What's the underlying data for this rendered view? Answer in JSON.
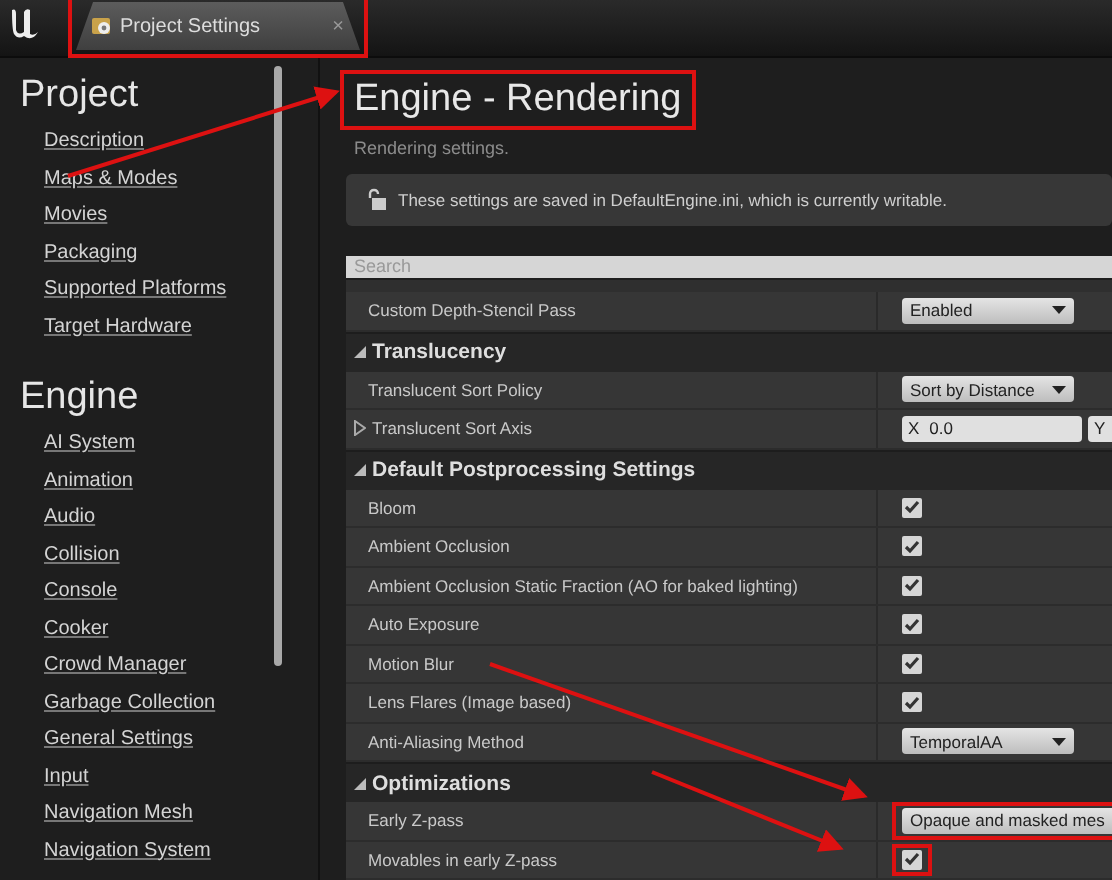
{
  "tab": {
    "title": "Project Settings",
    "close": "×",
    "highlighted": true
  },
  "sidebar": {
    "groups": [
      {
        "heading": "Project",
        "items": [
          "Description",
          "Maps & Modes",
          "Movies",
          "Packaging",
          "Supported Platforms",
          "Target Hardware"
        ]
      },
      {
        "heading": "Engine",
        "items": [
          "AI System",
          "Animation",
          "Audio",
          "Collision",
          "Console",
          "Cooker",
          "Crowd Manager",
          "Garbage Collection",
          "General Settings",
          "Input",
          "Navigation Mesh",
          "Navigation System"
        ]
      }
    ]
  },
  "page": {
    "title": "Engine - Rendering",
    "title_highlighted": true,
    "subtitle": "Rendering settings.",
    "notice": "These settings are saved in DefaultEngine.ini, which is currently writable.",
    "search": {
      "placeholder": "Search"
    }
  },
  "sections": [
    {
      "rows": [
        {
          "kind": "dropdown",
          "label": "Custom Depth-Stencil Pass",
          "value": "Enabled"
        }
      ]
    },
    {
      "title": "Translucency",
      "expanded": true,
      "rows": [
        {
          "kind": "dropdown",
          "label": "Translucent Sort Policy",
          "value": "Sort by Distance"
        },
        {
          "kind": "vector",
          "label": "Translucent Sort Axis",
          "expanded": false,
          "fields": [
            {
              "axis": "X",
              "value": "0.0"
            },
            {
              "axis": "Y"
            }
          ]
        }
      ]
    },
    {
      "title": "Default Postprocessing Settings",
      "expanded": true,
      "rows": [
        {
          "kind": "checkbox",
          "label": "Bloom",
          "checked": true
        },
        {
          "kind": "checkbox",
          "label": "Ambient Occlusion",
          "checked": true
        },
        {
          "kind": "checkbox",
          "label": "Ambient Occlusion Static Fraction (AO for baked lighting)",
          "checked": true
        },
        {
          "kind": "checkbox",
          "label": "Auto Exposure",
          "checked": true
        },
        {
          "kind": "checkbox",
          "label": "Motion Blur",
          "checked": true
        },
        {
          "kind": "checkbox",
          "label": "Lens Flares (Image based)",
          "checked": true
        },
        {
          "kind": "dropdown",
          "label": "Anti-Aliasing Method",
          "value": "TemporalAA"
        }
      ]
    },
    {
      "title": "Optimizations",
      "expanded": true,
      "rows": [
        {
          "kind": "dropdown",
          "label": "Early Z-pass",
          "value": "Opaque and masked mes",
          "highlighted": true,
          "wide": true
        },
        {
          "kind": "checkbox",
          "label": "Movables in early Z-pass",
          "checked": true,
          "highlighted": true
        }
      ]
    }
  ]
}
